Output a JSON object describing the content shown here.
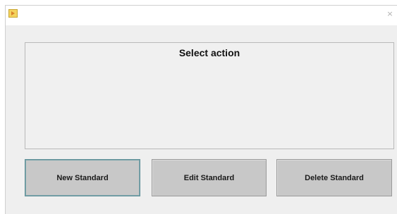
{
  "window": {
    "icon": "matlab-figure-icon",
    "close_label": "×"
  },
  "panel": {
    "title": "Select action"
  },
  "buttons": [
    {
      "label": "New Standard",
      "selected": true
    },
    {
      "label": "Edit Standard",
      "selected": false
    },
    {
      "label": "Delete Standard",
      "selected": false
    }
  ],
  "colors": {
    "window_bg": "#efefef",
    "button_bg": "#c8c8c8",
    "selected_border": "#5e8f97"
  }
}
